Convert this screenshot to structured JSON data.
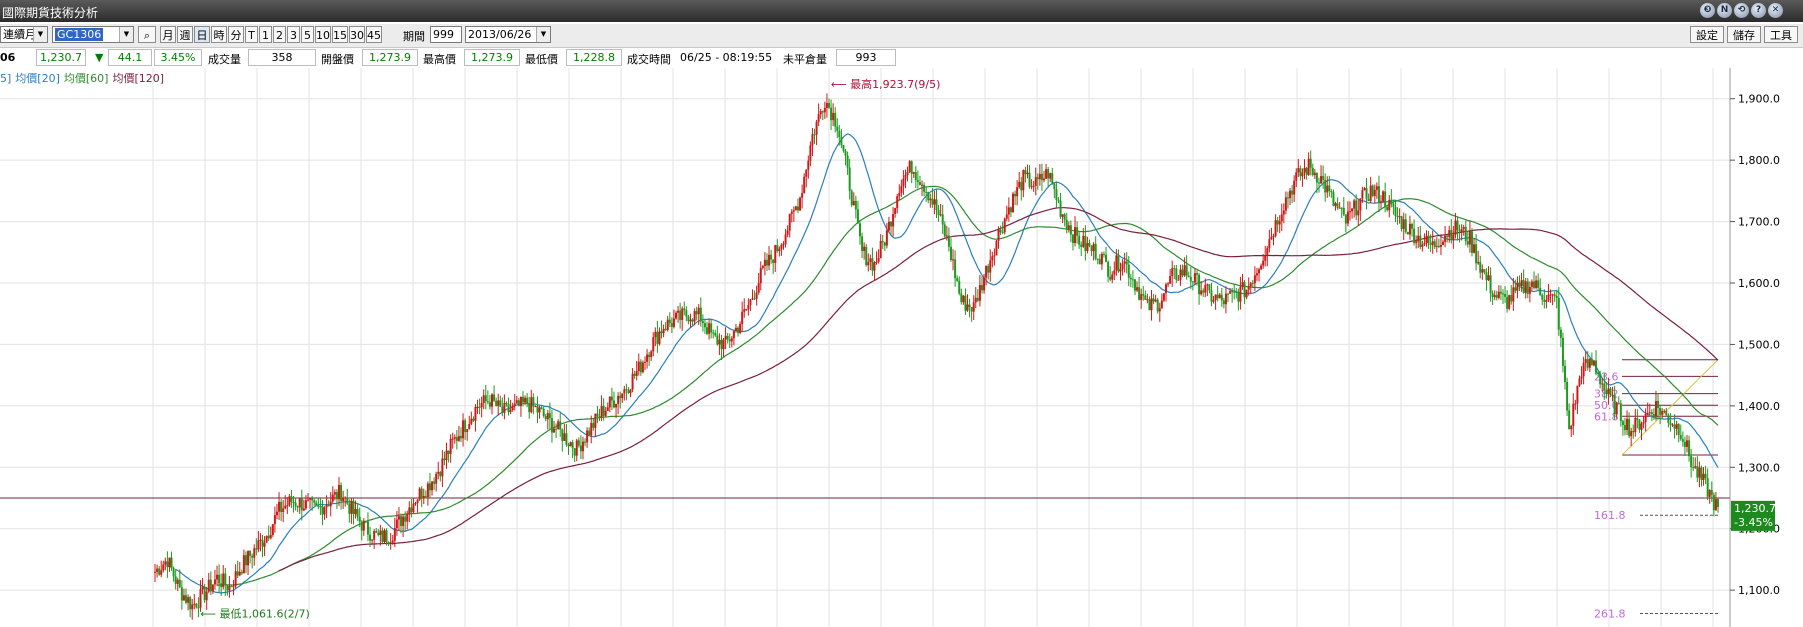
{
  "window": {
    "title": "國際期貨技術分析",
    "buttons": [
      "❸",
      "N",
      "⟲",
      "?",
      "✕"
    ]
  },
  "toolbar": {
    "contract_select": "連續月",
    "symbol_input": "GC1306",
    "period_buttons": [
      "月",
      "週",
      "日",
      "時",
      "分",
      "T",
      "1",
      "2",
      "3",
      "5",
      "10",
      "15",
      "30",
      "45"
    ],
    "active_period": "日",
    "period_label": "期間",
    "period_value": "999",
    "date_value": "2013/06/26",
    "right_buttons": [
      "設定",
      "儲存",
      "工具"
    ]
  },
  "quote": {
    "code": "06",
    "price": "1,230.7",
    "change_arrow": "▼",
    "change": "44.1",
    "change_pct": "3.45%",
    "volume_label": "成交量",
    "volume": "358",
    "open_label": "開盤價",
    "open": "1,273.9",
    "high_label": "最高價",
    "high": "1,273.9",
    "low_label": "最低價",
    "low": "1,228.8",
    "time_label": "成交時間",
    "time": "06/25 - 08:19:55",
    "oi_label": "未平倉量",
    "oi": "993"
  },
  "legend": {
    "items": [
      {
        "label": "5]",
        "color": "#2a7fbf"
      },
      {
        "label": "均價[20]",
        "color": "#2a7fbf"
      },
      {
        "label": "均價[60]",
        "color": "#2e8b2e"
      },
      {
        "label": "均價[120]",
        "color": "#7a1f3d"
      }
    ]
  },
  "chart_data": {
    "type": "line",
    "title": "",
    "ylim": [
      1040,
      1950
    ],
    "y_ticks": [
      "1,100.0",
      "1,200.0",
      "1,300.0",
      "1,400.0",
      "1,500.0",
      "1,600.0",
      "1,700.0",
      "1,800.0",
      "1,900.0"
    ],
    "y_tick_values": [
      1100,
      1200,
      1300,
      1400,
      1500,
      1600,
      1700,
      1800,
      1900
    ],
    "grid": true,
    "x_index_range": [
      0,
      100
    ],
    "price_path": [
      [
        0,
        1130
      ],
      [
        1,
        1150
      ],
      [
        2,
        1100
      ],
      [
        3,
        1075
      ],
      [
        4,
        1095
      ],
      [
        5,
        1120
      ],
      [
        6,
        1105
      ],
      [
        7,
        1140
      ],
      [
        8,
        1165
      ],
      [
        9,
        1190
      ],
      [
        10,
        1230
      ],
      [
        11,
        1245
      ],
      [
        12,
        1240
      ],
      [
        13,
        1230
      ],
      [
        14,
        1245
      ],
      [
        15,
        1260
      ],
      [
        16,
        1225
      ],
      [
        17,
        1200
      ],
      [
        18,
        1185
      ],
      [
        19,
        1190
      ],
      [
        20,
        1220
      ],
      [
        21,
        1250
      ],
      [
        22,
        1270
      ],
      [
        23,
        1300
      ],
      [
        24,
        1340
      ],
      [
        25,
        1370
      ],
      [
        26,
        1400
      ],
      [
        27,
        1410
      ],
      [
        28,
        1390
      ],
      [
        29,
        1395
      ],
      [
        30,
        1405
      ],
      [
        31,
        1390
      ],
      [
        32,
        1370
      ],
      [
        33,
        1350
      ],
      [
        34,
        1330
      ],
      [
        35,
        1360
      ],
      [
        36,
        1390
      ],
      [
        37,
        1410
      ],
      [
        38,
        1430
      ],
      [
        39,
        1460
      ],
      [
        40,
        1500
      ],
      [
        41,
        1530
      ],
      [
        42,
        1540
      ],
      [
        43,
        1550
      ],
      [
        44,
        1545
      ],
      [
        45,
        1510
      ],
      [
        46,
        1500
      ],
      [
        47,
        1530
      ],
      [
        48,
        1570
      ],
      [
        49,
        1620
      ],
      [
        50,
        1650
      ],
      [
        51,
        1690
      ],
      [
        52,
        1740
      ],
      [
        53,
        1840
      ],
      [
        54,
        1900
      ],
      [
        55,
        1860
      ],
      [
        56,
        1760
      ],
      [
        57,
        1650
      ],
      [
        58,
        1630
      ],
      [
        59,
        1680
      ],
      [
        60,
        1760
      ],
      [
        61,
        1790
      ],
      [
        62,
        1760
      ],
      [
        63,
        1720
      ],
      [
        64,
        1660
      ],
      [
        65,
        1570
      ],
      [
        66,
        1560
      ],
      [
        67,
        1620
      ],
      [
        68,
        1680
      ],
      [
        69,
        1730
      ],
      [
        70,
        1770
      ],
      [
        71,
        1760
      ],
      [
        72,
        1780
      ],
      [
        73,
        1720
      ],
      [
        74,
        1680
      ],
      [
        75,
        1660
      ],
      [
        76,
        1650
      ],
      [
        77,
        1620
      ],
      [
        78,
        1640
      ],
      [
        79,
        1600
      ],
      [
        80,
        1560
      ],
      [
        81,
        1570
      ],
      [
        82,
        1610
      ],
      [
        83,
        1620
      ],
      [
        84,
        1600
      ],
      [
        85,
        1580
      ],
      [
        86,
        1570
      ],
      [
        87,
        1580
      ],
      [
        88,
        1590
      ],
      [
        89,
        1630
      ],
      [
        90,
        1680
      ],
      [
        91,
        1730
      ],
      [
        92,
        1770
      ],
      [
        93,
        1790
      ],
      [
        94,
        1770
      ],
      [
        95,
        1730
      ],
      [
        96,
        1700
      ],
      [
        97,
        1730
      ],
      [
        98,
        1750
      ],
      [
        99,
        1740
      ],
      [
        100,
        1710
      ],
      [
        101,
        1690
      ],
      [
        102,
        1670
      ],
      [
        103,
        1660
      ],
      [
        104,
        1680
      ],
      [
        105,
        1690
      ],
      [
        106,
        1670
      ],
      [
        107,
        1620
      ],
      [
        108,
        1580
      ],
      [
        109,
        1570
      ],
      [
        110,
        1590
      ],
      [
        111,
        1600
      ],
      [
        112,
        1580
      ],
      [
        113,
        1570
      ],
      [
        114,
        1360
      ],
      [
        115,
        1460
      ],
      [
        116,
        1470
      ],
      [
        117,
        1420
      ],
      [
        118,
        1390
      ],
      [
        119,
        1360
      ],
      [
        120,
        1380
      ],
      [
        121,
        1400
      ],
      [
        122,
        1380
      ],
      [
        123,
        1360
      ],
      [
        124,
        1300
      ],
      [
        125,
        1270
      ],
      [
        126,
        1230
      ]
    ],
    "series": [
      {
        "name": "均價[20]",
        "color": "#2a7fbf"
      },
      {
        "name": "均價[60]",
        "color": "#2e8b2e"
      },
      {
        "name": "均價[120]",
        "color": "#7a1f3d"
      }
    ],
    "annotations": {
      "high": "最高1,923.7(9/5)",
      "high_value": 1923.7,
      "high_index": 54,
      "low": "最低1,061.6(2/7)",
      "low_value": 1061.6,
      "low_index": 3
    },
    "fibonacci": [
      {
        "label": "23.6",
        "value": 1448
      },
      {
        "label": "38.2",
        "value": 1420
      },
      {
        "label": "50.0",
        "value": 1401
      },
      {
        "label": "61.8",
        "value": 1383
      },
      {
        "label": "161.8",
        "value": 1222
      },
      {
        "label": "261.8",
        "value": 1062
      }
    ],
    "horizontal_line": 1250,
    "last_price": {
      "label": "1,230.7",
      "pct": "-3.45%",
      "value": 1230.7
    }
  }
}
